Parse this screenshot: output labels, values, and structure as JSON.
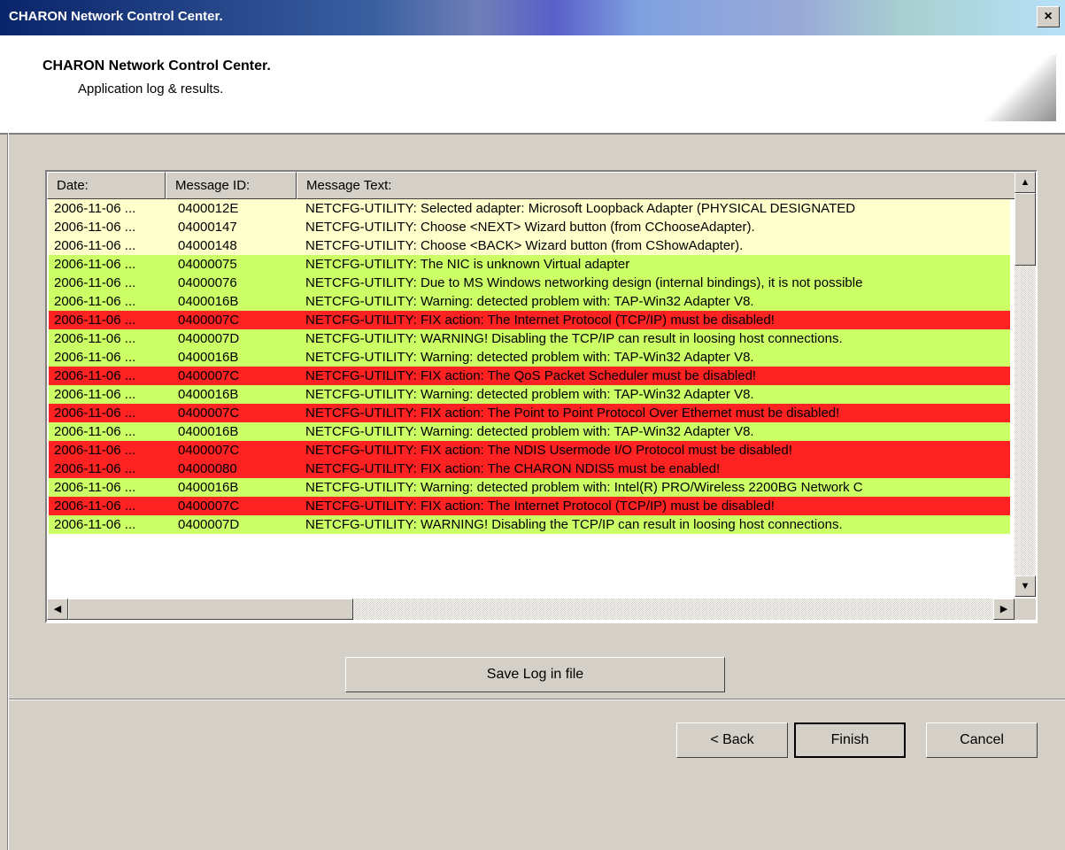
{
  "window": {
    "title": "CHARON Network Control Center.",
    "close_glyph": "×"
  },
  "header": {
    "title": "CHARON Network Control Center.",
    "subtitle": "Application log & results."
  },
  "log": {
    "columns": [
      "Date:",
      "Message ID:",
      "Message Text:"
    ],
    "rows": [
      {
        "date": "2006-11-06 ...",
        "id": "0400012E",
        "text": "NETCFG-UTILITY: Selected adapter: Microsoft Loopback Adapter (PHYSICAL DESIGNATED",
        "level": "yellow"
      },
      {
        "date": "2006-11-06 ...",
        "id": "04000147",
        "text": "NETCFG-UTILITY: Choose <NEXT> Wizard button (from CChooseAdapter).",
        "level": "yellow"
      },
      {
        "date": "2006-11-06 ...",
        "id": "04000148",
        "text": "NETCFG-UTILITY: Choose <BACK> Wizard button (from CShowAdapter).",
        "level": "yellow"
      },
      {
        "date": "2006-11-06 ...",
        "id": "04000075",
        "text": "NETCFG-UTILITY: The NIC is unknown Virtual adapter",
        "level": "green"
      },
      {
        "date": "2006-11-06 ...",
        "id": "04000076",
        "text": "NETCFG-UTILITY: Due to MS Windows networking design (internal bindings), it is not possible",
        "level": "green"
      },
      {
        "date": "2006-11-06 ...",
        "id": "0400016B",
        "text": "NETCFG-UTILITY: Warning: detected problem with: TAP-Win32 Adapter V8.",
        "level": "green"
      },
      {
        "date": "2006-11-06 ...",
        "id": "0400007C",
        "text": "NETCFG-UTILITY: FIX action: The Internet Protocol (TCP/IP) must be disabled!",
        "level": "red"
      },
      {
        "date": "2006-11-06 ...",
        "id": "0400007D",
        "text": "NETCFG-UTILITY: WARNING! Disabling the TCP/IP can result in loosing host connections.",
        "level": "green"
      },
      {
        "date": "2006-11-06 ...",
        "id": "0400016B",
        "text": "NETCFG-UTILITY: Warning: detected problem with: TAP-Win32 Adapter V8.",
        "level": "green"
      },
      {
        "date": "2006-11-06 ...",
        "id": "0400007C",
        "text": "NETCFG-UTILITY: FIX action: The QoS Packet Scheduler must be disabled!",
        "level": "red"
      },
      {
        "date": "2006-11-06 ...",
        "id": "0400016B",
        "text": "NETCFG-UTILITY: Warning: detected problem with: TAP-Win32 Adapter V8.",
        "level": "green"
      },
      {
        "date": "2006-11-06 ...",
        "id": "0400007C",
        "text": "NETCFG-UTILITY: FIX action: The Point to Point Protocol Over Ethernet must be disabled!",
        "level": "red"
      },
      {
        "date": "2006-11-06 ...",
        "id": "0400016B",
        "text": "NETCFG-UTILITY: Warning: detected problem with: TAP-Win32 Adapter V8.",
        "level": "green"
      },
      {
        "date": "2006-11-06 ...",
        "id": "0400007C",
        "text": "NETCFG-UTILITY: FIX action: The NDIS Usermode I/O Protocol must be disabled!",
        "level": "red"
      },
      {
        "date": "2006-11-06 ...",
        "id": "04000080",
        "text": "NETCFG-UTILITY: FIX action: The CHARON NDIS5 must be enabled!",
        "level": "red"
      },
      {
        "date": "2006-11-06 ...",
        "id": "0400016B",
        "text": "NETCFG-UTILITY: Warning: detected problem with: Intel(R) PRO/Wireless 2200BG Network C",
        "level": "green"
      },
      {
        "date": "2006-11-06 ...",
        "id": "0400007C",
        "text": "NETCFG-UTILITY: FIX action: The Internet Protocol (TCP/IP) must be disabled!",
        "level": "red"
      },
      {
        "date": "2006-11-06 ...",
        "id": "0400007D",
        "text": "NETCFG-UTILITY: WARNING! Disabling the TCP/IP can result in loosing host connections.",
        "level": "green"
      }
    ]
  },
  "scroll": {
    "up_glyph": "▲",
    "down_glyph": "▼",
    "left_glyph": "◀",
    "right_glyph": "▶"
  },
  "buttons": {
    "save": "Save Log in file",
    "back": "< Back",
    "finish": "Finish",
    "cancel": "Cancel"
  },
  "colors": {
    "yellow": "#ffffcc",
    "green": "#ccff66",
    "red": "#ff2222"
  }
}
